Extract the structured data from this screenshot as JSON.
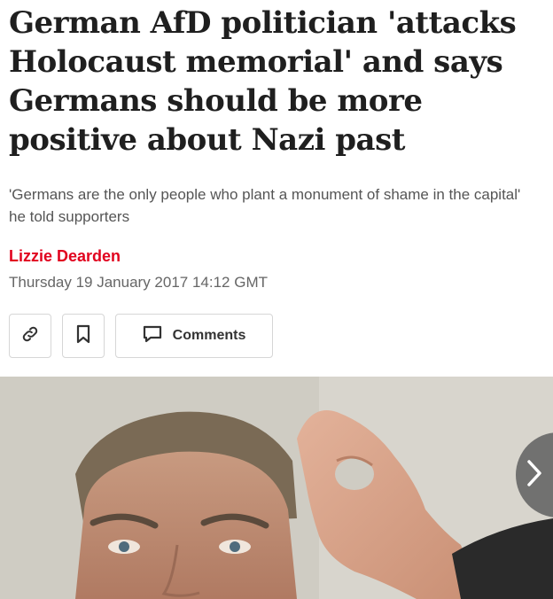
{
  "article": {
    "headline": "German AfD politician 'attacks Holocaust memorial' and says Germans should be more positive about Nazi past",
    "standfirst": "'Germans are the only people who plant a monument of shame in the capital' he told supporters",
    "author": "Lizzie Dearden",
    "date": "Thursday 19 January 2017 14:12 GMT"
  },
  "actions": {
    "link_icon": "link-icon",
    "bookmark_icon": "bookmark-icon",
    "comments_icon": "comment-icon",
    "comments_label": "Comments"
  },
  "gallery": {
    "next_icon": "chevron-right-icon"
  },
  "colors": {
    "author": "#e1021e",
    "headline": "#1f1f1f",
    "standfirst": "#555555",
    "date": "#666666"
  }
}
